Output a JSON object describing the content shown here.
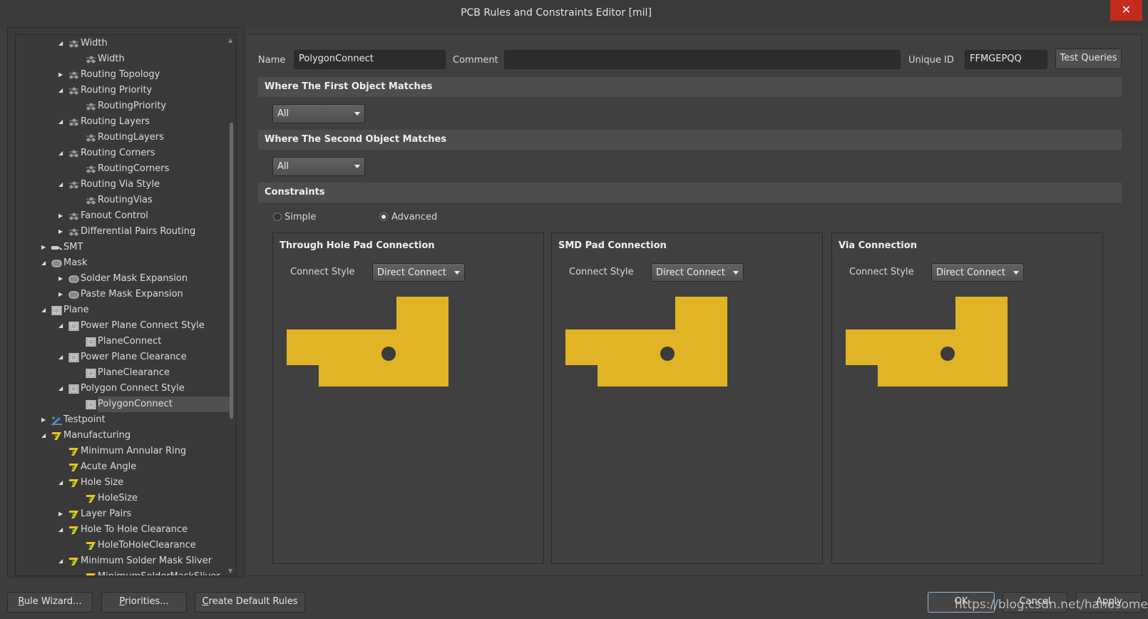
{
  "window": {
    "title": "PCB Rules and Constraints Editor [mil]",
    "close_icon": "close-icon"
  },
  "tree": [
    {
      "label": "Width",
      "level": 2,
      "exp": "open",
      "icon": "routing"
    },
    {
      "label": "Width",
      "level": 3,
      "exp": "",
      "icon": "routing"
    },
    {
      "label": "Routing Topology",
      "level": 2,
      "exp": "closed",
      "icon": "routing"
    },
    {
      "label": "Routing Priority",
      "level": 2,
      "exp": "open",
      "icon": "routing"
    },
    {
      "label": "RoutingPriority",
      "level": 3,
      "exp": "",
      "icon": "routing"
    },
    {
      "label": "Routing Layers",
      "level": 2,
      "exp": "open",
      "icon": "routing"
    },
    {
      "label": "RoutingLayers",
      "level": 3,
      "exp": "",
      "icon": "routing"
    },
    {
      "label": "Routing Corners",
      "level": 2,
      "exp": "open",
      "icon": "routing"
    },
    {
      "label": "RoutingCorners",
      "level": 3,
      "exp": "",
      "icon": "routing"
    },
    {
      "label": "Routing Via Style",
      "level": 2,
      "exp": "open",
      "icon": "routing"
    },
    {
      "label": "RoutingVias",
      "level": 3,
      "exp": "",
      "icon": "routing"
    },
    {
      "label": "Fanout Control",
      "level": 2,
      "exp": "closed",
      "icon": "routing"
    },
    {
      "label": "Differential Pairs Routing",
      "level": 2,
      "exp": "closed",
      "icon": "routing"
    },
    {
      "label": "SMT",
      "level": 1,
      "exp": "closed",
      "icon": "smt"
    },
    {
      "label": "Mask",
      "level": 1,
      "exp": "open",
      "icon": "mask"
    },
    {
      "label": "Solder Mask Expansion",
      "level": 2,
      "exp": "closed",
      "icon": "mask"
    },
    {
      "label": "Paste Mask Expansion",
      "level": 2,
      "exp": "closed",
      "icon": "mask"
    },
    {
      "label": "Plane",
      "level": 1,
      "exp": "open",
      "icon": "plane"
    },
    {
      "label": "Power Plane Connect Style",
      "level": 2,
      "exp": "open",
      "icon": "plane"
    },
    {
      "label": "PlaneConnect",
      "level": 3,
      "exp": "",
      "icon": "plane"
    },
    {
      "label": "Power Plane Clearance",
      "level": 2,
      "exp": "open",
      "icon": "plane"
    },
    {
      "label": "PlaneClearance",
      "level": 3,
      "exp": "",
      "icon": "plane"
    },
    {
      "label": "Polygon Connect Style",
      "level": 2,
      "exp": "open",
      "icon": "plane"
    },
    {
      "label": "PolygonConnect",
      "level": 3,
      "exp": "",
      "icon": "plane",
      "selected": true
    },
    {
      "label": "Testpoint",
      "level": 1,
      "exp": "closed",
      "icon": "testpoint"
    },
    {
      "label": "Manufacturing",
      "level": 1,
      "exp": "open",
      "icon": "mfg"
    },
    {
      "label": "Minimum Annular Ring",
      "level": 2,
      "exp": "",
      "icon": "mfg"
    },
    {
      "label": "Acute Angle",
      "level": 2,
      "exp": "",
      "icon": "mfg"
    },
    {
      "label": "Hole Size",
      "level": 2,
      "exp": "open",
      "icon": "mfg"
    },
    {
      "label": "HoleSize",
      "level": 3,
      "exp": "",
      "icon": "mfg"
    },
    {
      "label": "Layer Pairs",
      "level": 2,
      "exp": "closed",
      "icon": "mfg"
    },
    {
      "label": "Hole To Hole Clearance",
      "level": 2,
      "exp": "open",
      "icon": "mfg"
    },
    {
      "label": "HoleToHoleClearance",
      "level": 3,
      "exp": "",
      "icon": "mfg"
    },
    {
      "label": "Minimum Solder Mask Sliver",
      "level": 2,
      "exp": "open",
      "icon": "mfg"
    },
    {
      "label": "MinimumSolderMaskSliver",
      "level": 3,
      "exp": "",
      "icon": "mfg"
    }
  ],
  "rule": {
    "name_label": "Name",
    "name_value": "PolygonConnect",
    "comment_label": "Comment",
    "comment_value": "",
    "uid_label": "Unique ID",
    "uid_value": "FFMGEPQQ",
    "test_queries": "Test Queries"
  },
  "first_match": {
    "header": "Where The First Object Matches",
    "value": "All"
  },
  "second_match": {
    "header": "Where The Second Object Matches",
    "value": "All"
  },
  "constraints": {
    "header": "Constraints",
    "simple": "Simple",
    "advanced": "Advanced",
    "mode": "Advanced",
    "panels": [
      {
        "title": "Through Hole Pad Connection",
        "cs_label": "Connect Style",
        "cs_value": "Direct Connect"
      },
      {
        "title": "SMD Pad Connection",
        "cs_label": "Connect Style",
        "cs_value": "Direct Connect"
      },
      {
        "title": "Via Connection",
        "cs_label": "Connect Style",
        "cs_value": "Direct Connect"
      }
    ],
    "copper_color": "#e0b425"
  },
  "buttons": {
    "rule_wizard_u": "R",
    "rule_wizard": "ule Wizard...",
    "priorities_u": "P",
    "priorities": "riorities...",
    "create_u": "C",
    "create": "reate Default Rules",
    "ok": "OK",
    "cancel": "Cancel",
    "apply": "Apply"
  },
  "watermark": "https://blog.csdn.net/handsome_Ares"
}
